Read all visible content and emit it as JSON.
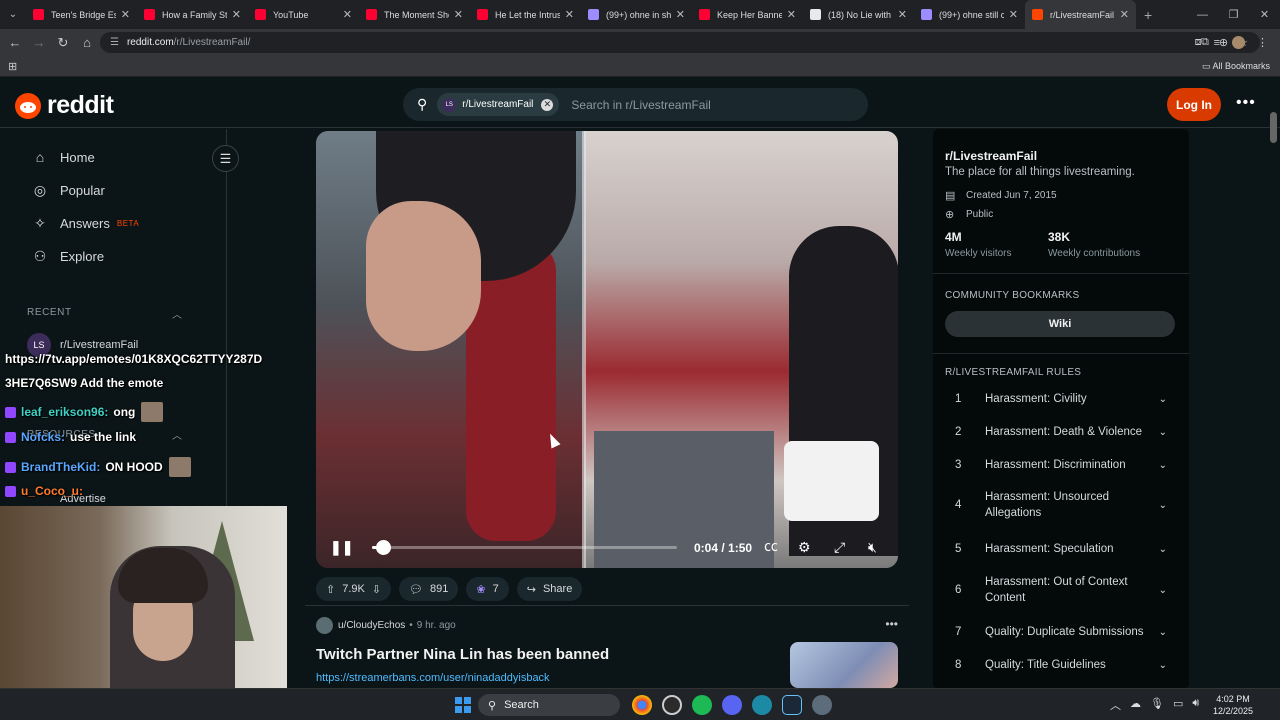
{
  "browser": {
    "tabs": [
      {
        "title": "Teen's Bridge Esca",
        "favicon_color": "#ff0033"
      },
      {
        "title": "How a Family Sto",
        "favicon_color": "#ff0033"
      },
      {
        "title": "YouTube",
        "favicon_color": "#ff0033"
      },
      {
        "title": "The Moment She",
        "favicon_color": "#ff0033"
      },
      {
        "title": "He Let the Intrusi",
        "favicon_color": "#ff0033"
      },
      {
        "title": "(99+) ohne in sho",
        "favicon_color": "#9b8cff"
      },
      {
        "title": "Keep Her Banned",
        "favicon_color": "#ff0033"
      },
      {
        "title": "(18) No Lie with E",
        "favicon_color": "#e7e9ea"
      },
      {
        "title": "(99+) ohne still co",
        "favicon_color": "#9b8cff"
      },
      {
        "title": "r/LivestreamFail",
        "favicon_color": "#ff4500",
        "active": true
      }
    ],
    "url_host": "reddit.com",
    "url_path": "/r/LivestreamFail/",
    "all_bookmarks": "All Bookmarks"
  },
  "header": {
    "wordmark": "reddit",
    "search_chip": "r/LivestreamFail",
    "search_chip_avatar": "LS",
    "search_placeholder": "Search in r/LivestreamFail",
    "login": "Log In"
  },
  "sidebar": {
    "nav": [
      {
        "label": "Home",
        "icon": "home-icon",
        "glyph": "⌂"
      },
      {
        "label": "Popular",
        "icon": "popular-icon",
        "glyph": "◎"
      },
      {
        "label": "Answers",
        "icon": "answers-icon",
        "glyph": "✧",
        "badge": "BETA"
      },
      {
        "label": "Explore",
        "icon": "explore-icon",
        "glyph": "⚇"
      }
    ],
    "recent_label": "RECENT",
    "recent_items": [
      {
        "label": "r/LivestreamFail",
        "avatar": "LS"
      }
    ],
    "resources_label": "RESOURCES",
    "advertise": "Advertise"
  },
  "chat_overlay": {
    "lines": [
      {
        "user": "",
        "text": "https://7tv.app/emotes/01K8XQC62TTYY287D"
      },
      {
        "user": "",
        "text": "3HE7Q6SW9 Add the emote"
      },
      {
        "user": "leaf_erikson96:",
        "text": "ong",
        "user_color": "#3fd1c4"
      },
      {
        "user": "Nofcks:",
        "text": "use the link",
        "user_color": "#5aa7ff"
      },
      {
        "user": "BrandTheKid:",
        "text": "ON HOOD",
        "user_color": "#5aa7ff"
      },
      {
        "user": "u_Coco_u:",
        "text": "",
        "user_color": "#ff7b2e"
      }
    ]
  },
  "video": {
    "current_time": "0:04",
    "duration": "1:50",
    "time_display": "0:04 / 1:50",
    "progress": 0.036
  },
  "post_actions": {
    "votes": "7.9K",
    "comments": "891",
    "awards": "7",
    "share": "Share"
  },
  "post2": {
    "user": "u/CloudyEchos",
    "time": "9 hr. ago",
    "title": "Twitch Partner Nina Lin has been banned",
    "link": "https://streamerbans.com/user/ninadaddyisback"
  },
  "community": {
    "name": "r/LivestreamFail",
    "description": "The place for all things livestreaming.",
    "created": "Created Jun 7, 2015",
    "visibility": "Public",
    "visitors": "4M",
    "visitors_label": "Weekly visitors",
    "contributions": "38K",
    "contributions_label": "Weekly contributions",
    "bookmarks_label": "COMMUNITY BOOKMARKS",
    "wiki": "Wiki",
    "rules_label": "R/LIVESTREAMFAIL RULES",
    "rules": [
      {
        "num": "1",
        "text": "Harassment: Civility"
      },
      {
        "num": "2",
        "text": "Harassment: Death & Violence"
      },
      {
        "num": "3",
        "text": "Harassment: Discrimination"
      },
      {
        "num": "4",
        "text": "Harassment: Unsourced Allegations"
      },
      {
        "num": "5",
        "text": "Harassment: Speculation"
      },
      {
        "num": "6",
        "text": "Harassment: Out of Context Content"
      },
      {
        "num": "7",
        "text": "Quality: Duplicate Submissions"
      },
      {
        "num": "8",
        "text": "Quality: Title Guidelines"
      }
    ]
  },
  "taskbar": {
    "search": "Search",
    "time": "4:02 PM",
    "date": "12/2/2025"
  }
}
